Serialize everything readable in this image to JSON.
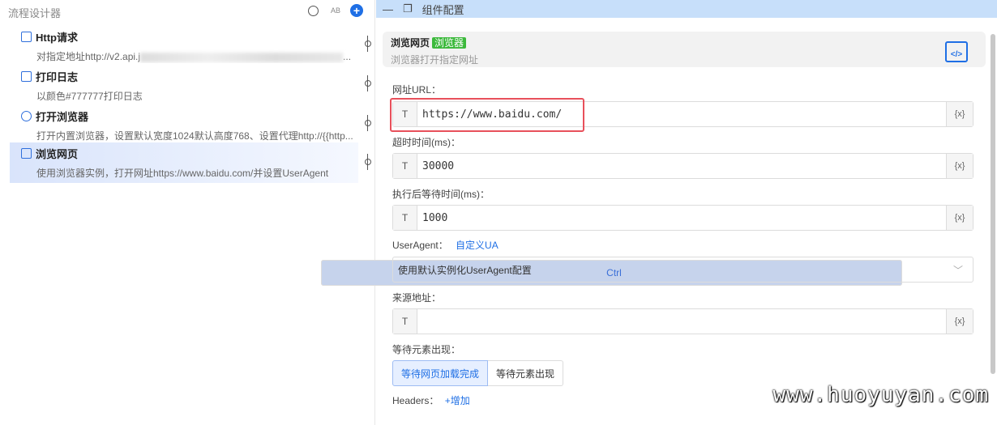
{
  "left": {
    "title": "流程设计器",
    "tools": {
      "ctrl": "Ctrl",
      "ab": "AB",
      "plus": "+"
    },
    "nodes": [
      {
        "title": "Http请求",
        "desc": "对指定地址http://v2.api.j",
        "desc_tail": "..."
      },
      {
        "title": "打印日志",
        "desc": "以颜色#777777打印日志"
      },
      {
        "title": "打开浏览器",
        "desc": "打开内置浏览器，设置默认宽度1024默认高度768、设置代理http://{{http..."
      },
      {
        "title": "浏览网页",
        "desc": "使用浏览器实例，打开网址https://www.baidu.com/并设置UserAgent"
      }
    ]
  },
  "right": {
    "header": "组件配置",
    "card": {
      "title": "浏览网页",
      "badge": "浏览器",
      "sub": "浏览器打开指定网址",
      "icon": "</>"
    },
    "url": {
      "label": "网址URL：",
      "type": "T",
      "value": "https://www.baidu.com/",
      "var": "{x}"
    },
    "timeout": {
      "label": "超时时间(ms)：",
      "type": "T",
      "value": "30000",
      "var": "{x}"
    },
    "wait": {
      "label": "执行后等待时间(ms)：",
      "type": "T",
      "value": "1000",
      "var": "{x}"
    },
    "ua": {
      "label": "UserAgent：",
      "link": "自定义UA",
      "select": "使用默认实例化UserAgent配置"
    },
    "referer": {
      "label": "来源地址：",
      "type": "T",
      "value": "",
      "var": "{x}"
    },
    "waitfor": {
      "label": "等待元素出现：",
      "options": [
        "等待网页加载完成",
        "等待元素出现"
      ]
    },
    "headers": {
      "label": "Headers：",
      "add": "+增加"
    }
  },
  "watermark": "www.huoyuyan.com"
}
